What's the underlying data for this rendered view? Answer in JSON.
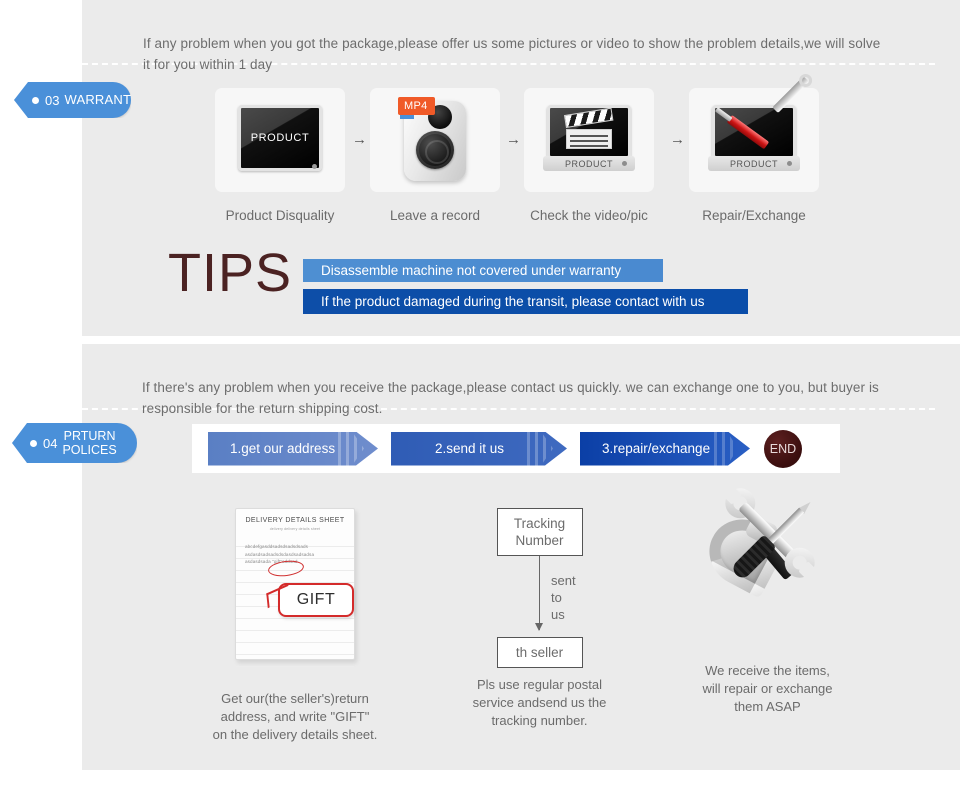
{
  "warranty_section": {
    "tag": {
      "number": "03",
      "label": "WARRANTY",
      "color": "#4a90d9"
    },
    "intro": "If any problem when you got the package,please offer us some pictures or video to show the problem details,we will solve\n it for you within 1 day",
    "steps": [
      {
        "caption": "Product Disquality",
        "icon": "monitor-product-icon",
        "screen_label": "PRODUCT"
      },
      {
        "caption": "Leave a record",
        "icon": "camera-recorder-icon",
        "badge": "MP4"
      },
      {
        "caption": "Check the video/pic",
        "icon": "monitor-clapperboard-icon",
        "base_label": "PRODUCT"
      },
      {
        "caption": "Repair/Exchange",
        "icon": "monitor-tools-icon",
        "base_label": "PRODUCT"
      }
    ],
    "arrow_glyph": "→",
    "tips": {
      "word": "TIPS",
      "lines": [
        {
          "text": "Disassemble machine not covered under warranty",
          "color": "#4a8ad0"
        },
        {
          "text": "If the product damaged during the transit, please contact with us",
          "color": "#0a4da9"
        }
      ]
    }
  },
  "return_section": {
    "tag": {
      "number": "04",
      "label": "PRTURN\nPOLICES",
      "color": "#4a90d9"
    },
    "intro": "If  there's any problem when you receive the package,please contact us quickly. we can exchange one to you, but buyer is\nresponsible for the return shipping cost.",
    "flow_steps": [
      {
        "label": "1.get our address",
        "color": "#6f8dcd"
      },
      {
        "label": "2.send it us",
        "color": "#3f6ac0"
      },
      {
        "label": "3.repair/exchange",
        "color": "#0b3fa6"
      }
    ],
    "end_badge": {
      "label": "END",
      "color": "#3a0e0e"
    },
    "columns": [
      {
        "icon": "delivery-details-sheet-icon",
        "sheet_title": "DELIVERY DETAILS SHEET",
        "sheet_subtitle": "delivery          delivery details sheet",
        "sheet_body": "abcdefgasddsadsdsadsdsads\nasdasdsadsadsdsdasdsadsadsa\nasdasdsada \"gift\"sddsad",
        "bubble_label": "GIFT",
        "caption": "Get our(the seller's)return\naddress, and write \"GIFT\"\non the delivery details sheet."
      },
      {
        "icon": "tracking-number-flow-icon",
        "box_top": "Tracking\nNumber",
        "arrow_label": "sent\nto us",
        "box_bottom": "th seller",
        "caption": "Pls use regular postal\nservice andsend us the\ntracking number."
      },
      {
        "icon": "hammer-wrench-screwdriver-icon",
        "caption": "We receive the items,\nwill repair or exchange\n them ASAP"
      }
    ]
  }
}
